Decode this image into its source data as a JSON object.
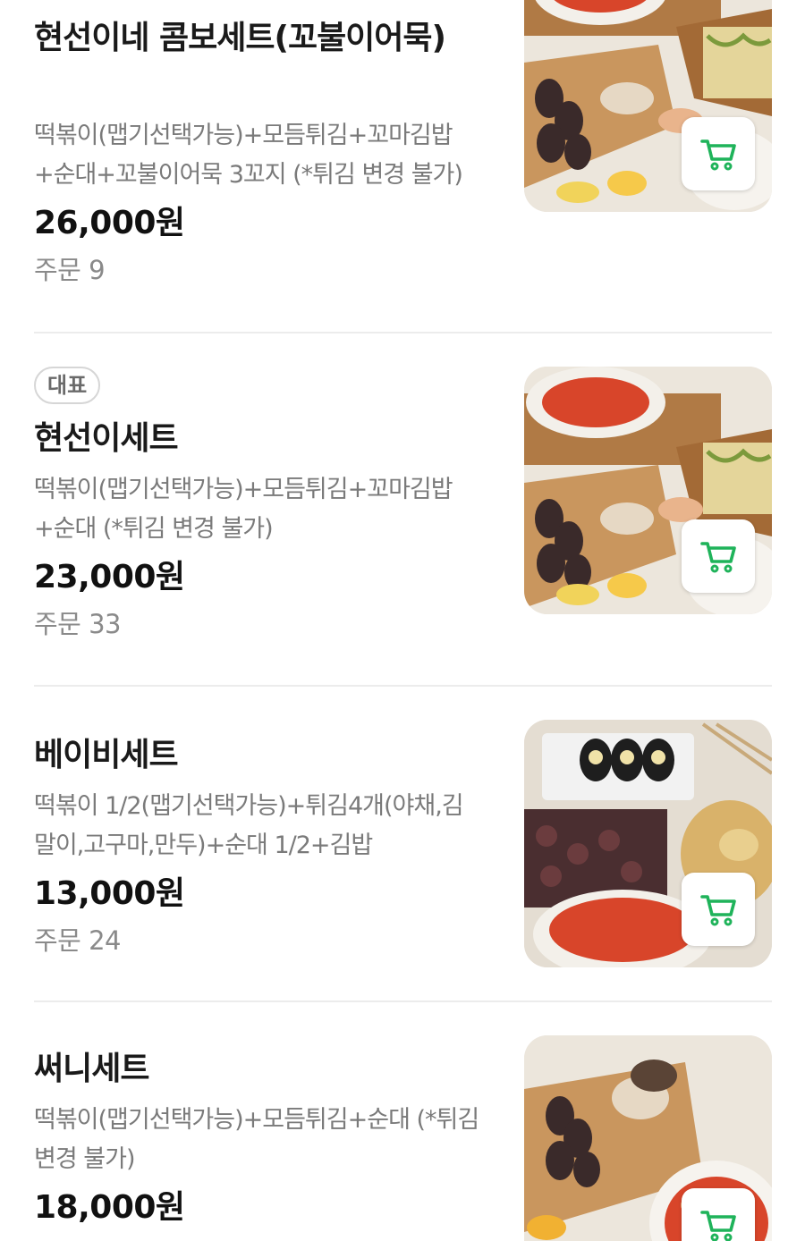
{
  "menu": {
    "items": [
      {
        "badge": "",
        "name": "현선이네 콤보세트(꼬불이어묵)",
        "description": "떡볶이(맵기선택가능)+모듬튀김+꼬마김밥+순대+꼬불이어묵 3꼬지 (*튀김 변경 불가)",
        "price": "26,000원",
        "orders": "주문 9"
      },
      {
        "badge": "대표",
        "name": "현선이세트",
        "description": "떡볶이(맵기선택가능)+모듬튀김+꼬마김밥+순대 (*튀김 변경 불가)",
        "price": "23,000원",
        "orders": "주문 33"
      },
      {
        "badge": "",
        "name": "베이비세트",
        "description": "떡볶이 1/2(맵기선택가능)+튀김4개(야채,김말이,고구마,만두)+순대 1/2+김밥",
        "price": "13,000원",
        "orders": "주문 24"
      },
      {
        "badge": "",
        "name": "써니세트",
        "description": "떡볶이(맵기선택가능)+모듬튀김+순대 (*튀김 변경 불가)",
        "price": "18,000원",
        "orders": ""
      }
    ]
  },
  "icons": {
    "cart": "shopping-cart-icon"
  },
  "colors": {
    "accent_green": "#1fb35a",
    "divider": "#ececec",
    "secondary_text": "#7a7a7a"
  }
}
